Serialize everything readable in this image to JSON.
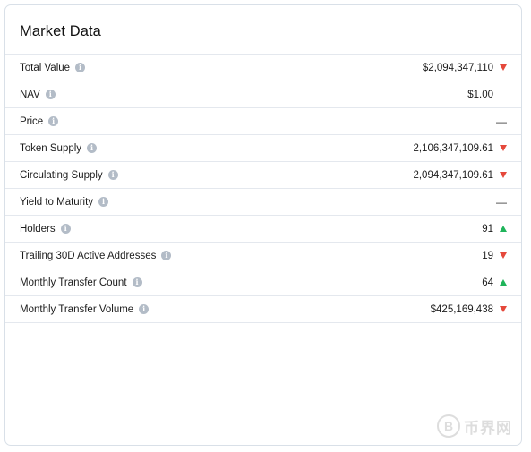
{
  "card": {
    "title": "Market Data"
  },
  "rows": [
    {
      "label": "Total Value",
      "value": "$2,094,347,110",
      "trend": "down"
    },
    {
      "label": "NAV",
      "value": "$1.00",
      "trend": "none"
    },
    {
      "label": "Price",
      "value": "—",
      "trend": "none"
    },
    {
      "label": "Token Supply",
      "value": "2,106,347,109.61",
      "trend": "down"
    },
    {
      "label": "Circulating Supply",
      "value": "2,094,347,109.61",
      "trend": "down"
    },
    {
      "label": "Yield to Maturity",
      "value": "—",
      "trend": "none"
    },
    {
      "label": "Holders",
      "value": "91",
      "trend": "up"
    },
    {
      "label": "Trailing 30D Active Addresses",
      "value": "19",
      "trend": "down"
    },
    {
      "label": "Monthly Transfer Count",
      "value": "64",
      "trend": "up"
    },
    {
      "label": "Monthly Transfer Volume",
      "value": "$425,169,438",
      "trend": "down"
    }
  ],
  "icons": {
    "info": "info-icon",
    "trend_up": "triangle-up-icon",
    "trend_down": "triangle-down-icon"
  },
  "colors": {
    "up": "#1fb45a",
    "down": "#e5483b",
    "border": "#e4e8ee",
    "info_icon": "#b3bcc7"
  },
  "watermark": {
    "logo_glyph": "B",
    "text": "币界网"
  }
}
